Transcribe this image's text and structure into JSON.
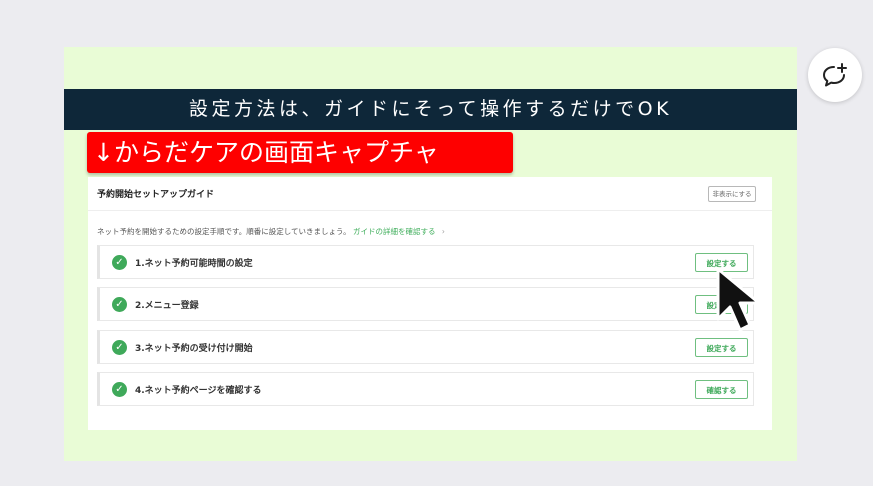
{
  "slide": {
    "banner_text": "設定方法は、ガイドにそって操作するだけでOK",
    "red_label": "↓からだケアの画面キャプチャ"
  },
  "guide": {
    "title": "予約開始セットアップガイド",
    "hide_button": "非表示にする",
    "intro_text": "ネット予約を開始するための設定手順です。順番に設定していきましょう。",
    "intro_link": "ガイドの詳細を確認する",
    "intro_chevron": "›",
    "steps": [
      {
        "label": "1.ネット予約可能時間の設定",
        "button": "設定する"
      },
      {
        "label": "2.メニュー登録",
        "button": "設定する"
      },
      {
        "label": "3.ネット予約の受け付け開始",
        "button": "設定する"
      },
      {
        "label": "4.ネット予約ページを確認する",
        "button": "確認する"
      }
    ]
  },
  "icons": {
    "step_check": "check-circle-icon",
    "cursor": "arrow-cursor-icon",
    "comment": "add-comment-icon"
  },
  "colors": {
    "banner_bg": "#0e2739",
    "red_label_bg": "#fe0000",
    "slide_bg": "#e9fcd6",
    "accent_green": "#3fa95a"
  }
}
